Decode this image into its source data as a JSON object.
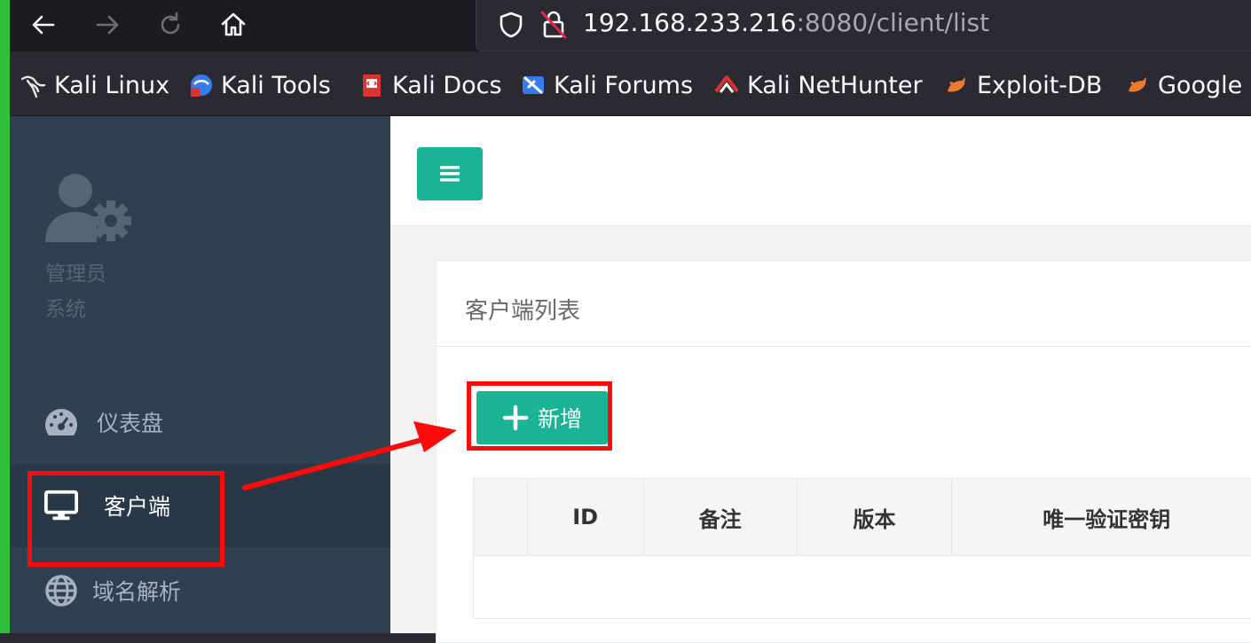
{
  "browser": {
    "url_host": "192.168.233.216",
    "url_rest": ":8080/client/list",
    "bookmarks": [
      {
        "label": "Kali Linux",
        "icon": "kali-dragon-icon"
      },
      {
        "label": "Kali Tools",
        "icon": "kali-tools-icon"
      },
      {
        "label": "Kali Docs",
        "icon": "kali-docs-icon"
      },
      {
        "label": "Kali Forums",
        "icon": "kali-forums-icon"
      },
      {
        "label": "Kali NetHunter",
        "icon": "kali-nethunter-icon"
      },
      {
        "label": "Exploit-DB",
        "icon": "exploit-db-icon"
      },
      {
        "label": "Google",
        "icon": "google-icon"
      }
    ]
  },
  "sidebar": {
    "user_name": "管理员",
    "user_role": "系统",
    "menu": [
      {
        "label": "仪表盘",
        "icon": "dashboard-gauge-icon",
        "active": false
      },
      {
        "label": "客户端",
        "icon": "desktop-monitor-icon",
        "active": true
      },
      {
        "label": "域名解析",
        "icon": "globe-icon",
        "active": false
      }
    ]
  },
  "main": {
    "panel_title": "客户端列表",
    "add_button_label": "新增",
    "table": {
      "columns": [
        "",
        "ID",
        "备注",
        "版本",
        "唯一验证密钥"
      ],
      "rows": []
    }
  },
  "colors": {
    "accent": "#1ab394",
    "sidebar_bg": "#2f4050",
    "sidebar_active_bg": "#293846",
    "annotation_red": "#ff0a0a"
  }
}
